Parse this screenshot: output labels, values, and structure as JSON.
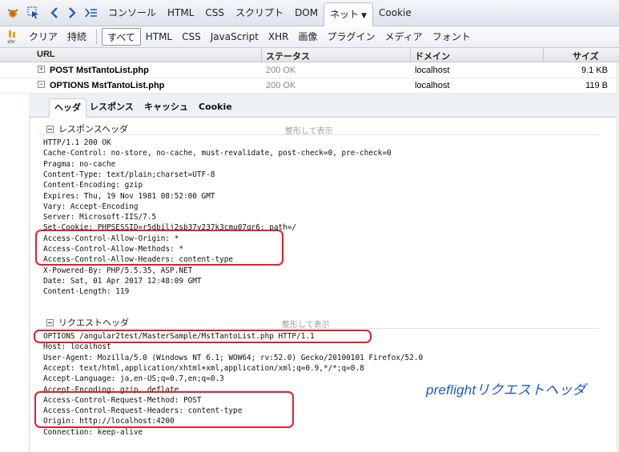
{
  "main_tabs": [
    {
      "label": "コンソール"
    },
    {
      "label": "HTML"
    },
    {
      "label": "CSS"
    },
    {
      "label": "スクリプト"
    },
    {
      "label": "DOM"
    },
    {
      "label": "ネット",
      "active": true
    },
    {
      "label": "Cookie"
    }
  ],
  "filters": {
    "xhr_icon_text": "xhr",
    "clear": "クリア",
    "persist": "持続",
    "items": [
      "すべて",
      "HTML",
      "CSS",
      "JavaScript",
      "XHR",
      "画像",
      "プラグイン",
      "メディア",
      "フォント"
    ]
  },
  "columns": {
    "url": "URL",
    "status": "ステータス",
    "domain": "ドメイン",
    "size": "サイズ"
  },
  "requests": [
    {
      "url": "POST MstTantoList.php",
      "status": "200 OK",
      "domain": "localhost",
      "size": "9.1 KB"
    },
    {
      "url": "OPTIONS MstTantoList.php",
      "status": "200 OK",
      "domain": "localhost",
      "size": "119 B"
    }
  ],
  "detail_tabs": [
    "ヘッダ",
    "レスポンス",
    "キャッシュ",
    "Cookie"
  ],
  "response_headers": {
    "title": "レスポンスヘッダ",
    "pretty": "整形して表示",
    "lines": [
      "HTTP/1.1 200 OK",
      "Cache-Control: no-store, no-cache, must-revalidate, post-check=0, pre-check=0",
      "Pragma: no-cache",
      "Content-Type: text/plain;charset=UTF-8",
      "Content-Encoding: gzip",
      "Expires: Thu, 19 Nov 1981 08:52:00 GMT",
      "Vary: Accept-Encoding",
      "Server: Microsoft-IIS/7.5",
      "Set-Cookie: PHPSESSID=r5dbilj2sb37v237k3cmu07gr6; path=/",
      "Access-Control-Allow-Origin: *",
      "Access-Control-Allow-Methods: *",
      "Access-Control-Allow-Headers: content-type",
      "X-Powered-By: PHP/5.5.35, ASP.NET",
      "Date: Sat, 01 Apr 2017 12:48:09 GMT",
      "Content-Length: 119"
    ]
  },
  "request_headers": {
    "title": "リクエストヘッダ",
    "pretty": "整形して表示",
    "lines": [
      "OPTIONS /angular2test/MasterSample/MstTantoList.php HTTP/1.1",
      "Host: localhost",
      "User-Agent: Mozilla/5.0 (Windows NT 6.1; WOW64; rv:52.0) Gecko/20100101 Firefox/52.0",
      "Accept: text/html,application/xhtml+xml,application/xml;q=0.9,*/*;q=0.8",
      "Accept-Language: ja,en-US;q=0.7,en;q=0.3",
      "Accept-Encoding: gzip, deflate",
      "Access-Control-Request-Method: POST",
      "Access-Control-Request-Headers: content-type",
      "Origin: http://localhost:4200",
      "Connection: keep-alive"
    ]
  },
  "annotation": "preflightリクエストヘッダ",
  "colors": {
    "highlight": "#e0202e",
    "annotation": "#1d56c9"
  }
}
